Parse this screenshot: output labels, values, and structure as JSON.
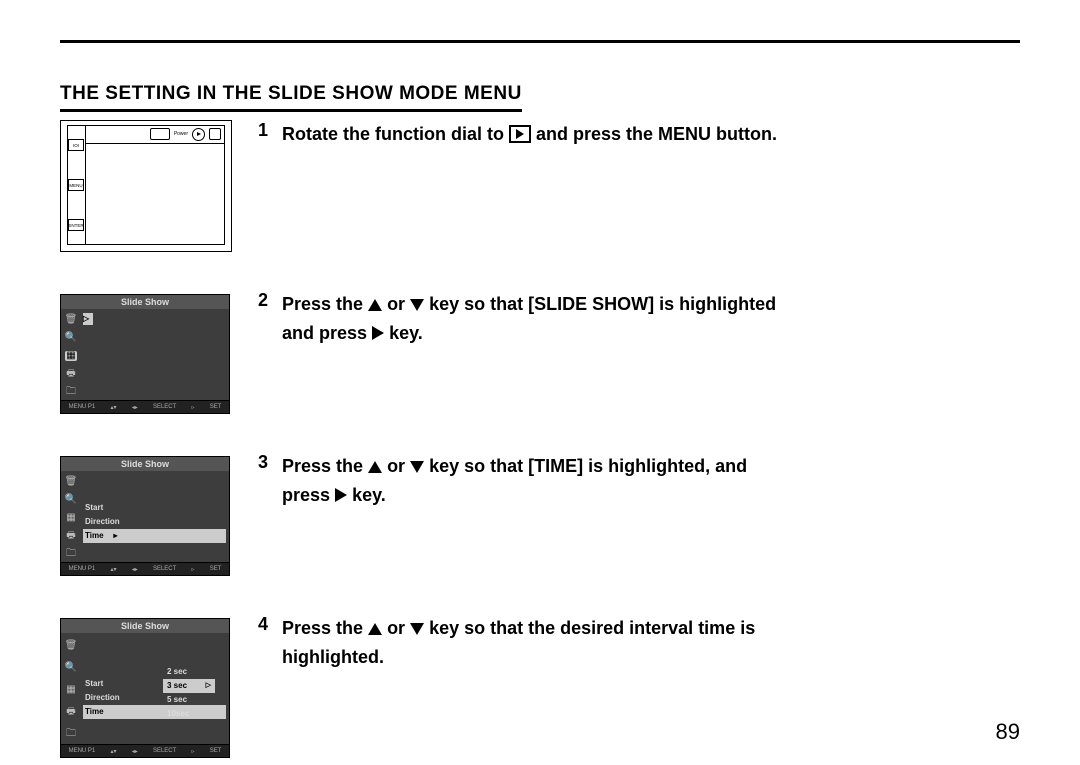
{
  "heading": "THE SETTING IN THE SLIDE SHOW MODE MENU",
  "page_number": "89",
  "steps": {
    "s1": {
      "num": "1",
      "pre": "Rotate the function dial to ",
      "post": " and press the MENU button."
    },
    "s2": {
      "num": "2",
      "pre": "Press the ",
      "mid1": " or ",
      "mid2": " key so that [SLIDE SHOW] is highlighted",
      "line2a": "and press ",
      "line2b": " key."
    },
    "s3": {
      "num": "3",
      "pre": "Press the ",
      "mid1": " or ",
      "mid2": " key so that [TIME] is highlighted, and",
      "line2a": "press ",
      "line2b": " key."
    },
    "s4": {
      "num": "4",
      "pre": "Press the ",
      "mid1": " or ",
      "mid2": " key so that the desired interval time is",
      "line2": "highlighted."
    }
  },
  "camera": {
    "power": "Power",
    "btns": [
      "IOI",
      "MENU",
      "ENTER"
    ]
  },
  "lcd": {
    "title": "Slide Show",
    "icons": [
      "🗑",
      "🔍",
      "▦",
      "🖶",
      "🗀"
    ],
    "footer": {
      "menu": "MENU P1",
      "select": "SELECT",
      "set": "SET"
    },
    "items2": [
      "Start",
      "Direction",
      "Time"
    ],
    "opts2": [
      "2 sec",
      "3 sec",
      "5 sec",
      "10sec"
    ]
  }
}
